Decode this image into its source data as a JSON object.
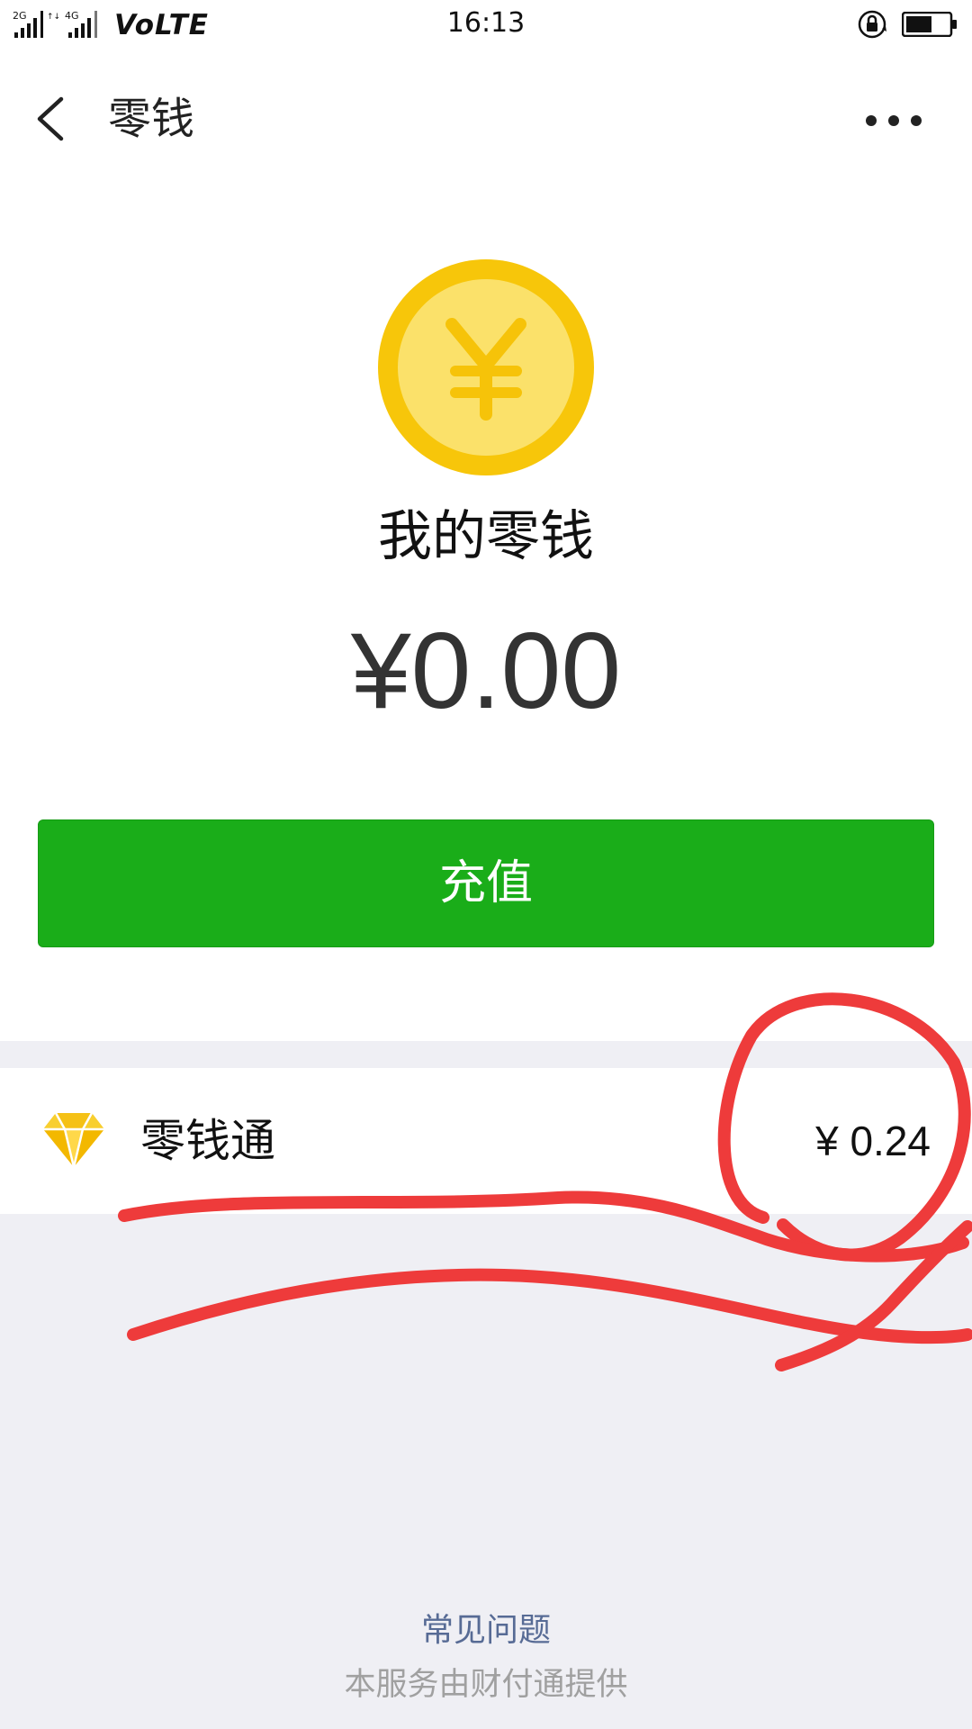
{
  "status_bar": {
    "time": "16:13",
    "network_label": "VoLTE",
    "signal_labels": [
      "2G",
      "4G"
    ]
  },
  "nav": {
    "title": "零钱"
  },
  "balance": {
    "label": "我的零钱",
    "amount": "¥0.00"
  },
  "recharge_button": {
    "label": "充值"
  },
  "list": {
    "items": [
      {
        "label": "零钱通",
        "value": "¥ 0.24",
        "icon": "diamond-icon"
      }
    ]
  },
  "footer": {
    "faq_link": "常见问题",
    "provider": "本服务由财付通提供"
  },
  "colors": {
    "primary_green": "#1aad19",
    "coin_yellow": "#f7c60a",
    "link_blue": "#576b95",
    "annotation_red": "#ee3b3b",
    "page_gray": "#efeff4"
  }
}
